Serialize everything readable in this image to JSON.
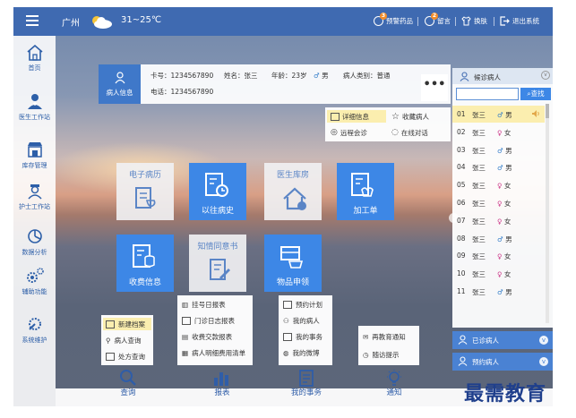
{
  "topbar": {
    "city": "广州",
    "temp": "31~25℃",
    "actions": [
      {
        "label": "预警药品",
        "badge": "3"
      },
      {
        "label": "留言",
        "badge": "2"
      },
      {
        "label": "换肤"
      },
      {
        "label": "退出系统"
      }
    ]
  },
  "sidebar": {
    "items": [
      {
        "label": "首页"
      },
      {
        "label": "医生工作站"
      },
      {
        "label": "库存管理"
      },
      {
        "label": "护士工作站"
      },
      {
        "label": "数据分析"
      },
      {
        "label": "辅助功能"
      },
      {
        "label": "系统维护"
      }
    ]
  },
  "patient": {
    "button_label": "病人信息",
    "card": "卡号：1234567890",
    "name": "姓名：张三",
    "age": "年龄：23岁",
    "gender": "男",
    "type": "病人类别：普通",
    "phone": "电话：1234567890",
    "more": "•••"
  },
  "patient_menu": {
    "items": [
      "详细信息",
      "收藏病人",
      "远程会诊",
      "在线对话"
    ]
  },
  "tiles": [
    {
      "label": "电子病历"
    },
    {
      "label": "以往病史"
    },
    {
      "label": "医生库房"
    },
    {
      "label": "加工单"
    },
    {
      "label": "收费信息"
    },
    {
      "label": "知情同意书"
    },
    {
      "label": "物品申领"
    }
  ],
  "waiting": {
    "title": "候诊病人",
    "search_placeholder": "",
    "search_label": "查找",
    "rows": [
      {
        "no": "01",
        "name": "张三",
        "gender": "男"
      },
      {
        "no": "02",
        "name": "张三",
        "gender": "女"
      },
      {
        "no": "03",
        "name": "张三",
        "gender": "男"
      },
      {
        "no": "04",
        "name": "张三",
        "gender": "男"
      },
      {
        "no": "05",
        "name": "张三",
        "gender": "女"
      },
      {
        "no": "06",
        "name": "张三",
        "gender": "女"
      },
      {
        "no": "07",
        "name": "张三",
        "gender": "女"
      },
      {
        "no": "08",
        "name": "张三",
        "gender": "男"
      },
      {
        "no": "09",
        "name": "张三",
        "gender": "女"
      },
      {
        "no": "10",
        "name": "张三",
        "gender": "女"
      },
      {
        "no": "11",
        "name": "张三",
        "gender": "男"
      }
    ],
    "male_symbol": "♂",
    "female_symbol": "♀"
  },
  "collapsed": [
    {
      "label": "已诊病人"
    },
    {
      "label": "预约病人"
    }
  ],
  "dock": {
    "items": [
      {
        "label": "查询"
      },
      {
        "label": "报表"
      },
      {
        "label": "我的事务"
      },
      {
        "label": "通知"
      }
    ]
  },
  "popups": {
    "query": [
      "新建档案",
      "病人查询",
      "处方查询"
    ],
    "report": [
      "挂号日报表",
      "门诊日志报表",
      "收费交款报表",
      "病人明细费用清单"
    ],
    "affairs": [
      "预约计划",
      "我的病人",
      "我的事务",
      "我的微博"
    ],
    "notice": [
      "再教育通知",
      "随访提示"
    ]
  },
  "watermark": "最需教育",
  "colors": {
    "primary": "#3f6ab1",
    "tile_blue": "#3d87e6",
    "highlight": "#fbeeaf"
  }
}
